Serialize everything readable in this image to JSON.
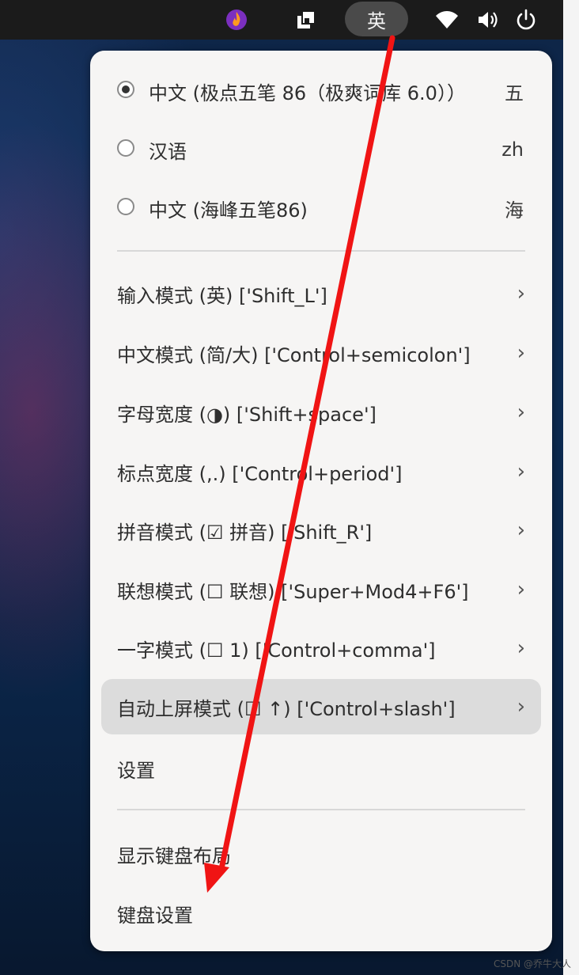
{
  "topbar": {
    "ime_indicator": "英",
    "icons": [
      "fcitx-flame-icon",
      "indicator-box-icon",
      "wifi-icon",
      "volume-icon",
      "power-icon"
    ]
  },
  "menu": {
    "input_methods": [
      {
        "label": "中文 (极点五笔 86（极爽词库 6.0））",
        "shortcut": "五",
        "selected": true
      },
      {
        "label": "汉语",
        "shortcut": "zh",
        "selected": false
      },
      {
        "label": "中文 (海峰五笔86)",
        "shortcut": "海",
        "selected": false
      }
    ],
    "submenus": [
      {
        "label": "输入模式 (英) ['Shift_L']"
      },
      {
        "label": "中文模式 (简/大) ['Control+semicolon']"
      },
      {
        "label": "字母宽度 (◑) ['Shift+space']"
      },
      {
        "label": "标点宽度 (,.) ['Control+period']"
      },
      {
        "label": "拼音模式 (☑ 拼音) ['Shift_R']"
      },
      {
        "label": "联想模式 (☐ 联想) ['Super+Mod4+F6']"
      },
      {
        "label": "一字模式 (☐ 1) ['Control+comma']"
      },
      {
        "label": "自动上屏模式 (☐ ↑) ['Control+slash']"
      }
    ],
    "settings_label": "设置",
    "show_layout_label": "显示键盘布局",
    "keyboard_settings_label": "键盘设置"
  },
  "watermark": "CSDN @乔牛大人"
}
